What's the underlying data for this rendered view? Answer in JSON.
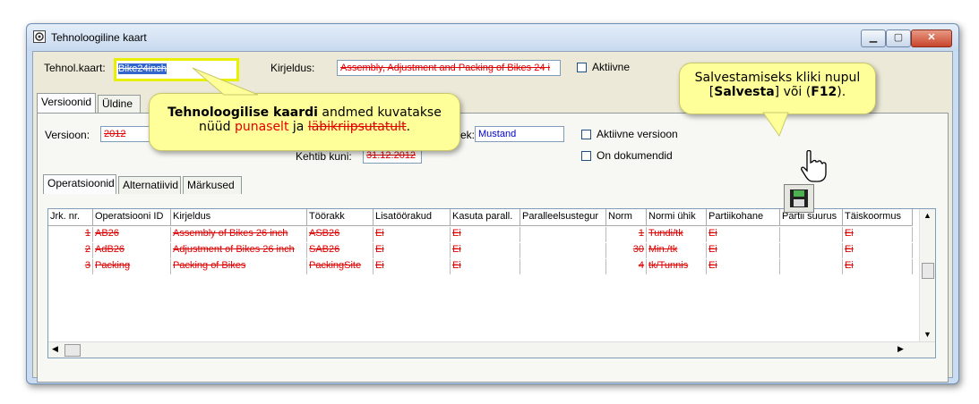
{
  "window": {
    "title": "Tehnoloogiline kaart"
  },
  "header": {
    "card_label": "Tehnol.kaart:",
    "card_value": "Bike24inch",
    "desc_label": "Kirjeldus:",
    "desc_value": "Assembly, Adjustment and Packing of Bikes 24 i",
    "active_label": "Aktiivne"
  },
  "top_tabs": [
    {
      "label": "Versioonid"
    },
    {
      "label": "Üldine"
    }
  ],
  "version": {
    "version_label": "Versioon:",
    "version_value": "2012",
    "status_label_suffix": "ek:",
    "status_value": "Mustand",
    "active_version_label": "Aktiivne versioon",
    "has_docs_label": "On dokumendid",
    "valid_until_label": "Kehtib kuni:",
    "valid_until_value": "31.12.2012"
  },
  "sub_tabs": [
    {
      "label": "Operatsioonid"
    },
    {
      "label": "Alternatiivid"
    },
    {
      "label": "Märkused"
    }
  ],
  "grid": {
    "columns": [
      "Jrk. nr.",
      "Operatsiooni ID",
      "Kirjeldus",
      "Töörakk",
      "Lisatöörakud",
      "Kasuta parall.",
      "Paralleelsustegur",
      "Norm",
      "Normi ühik",
      "Partiikohane",
      "Partii suurus",
      "Täiskoormus"
    ],
    "rows": [
      [
        "1",
        "AB26",
        "Assembly of Bikes 26 inch",
        "ASB26",
        "Ei",
        "Ei",
        "",
        "1",
        "Tundi/tk",
        "Ei",
        "",
        "Ei"
      ],
      [
        "2",
        "AdB26",
        "Adjustment of Bikes 26 inch",
        "SAB26",
        "Ei",
        "Ei",
        "",
        "30",
        "Min./tk",
        "Ei",
        "",
        "Ei"
      ],
      [
        "3",
        "Packing",
        "Packing of Bikes",
        "PackingSite",
        "Ei",
        "Ei",
        "",
        "4",
        "tk/Tunnis",
        "Ei",
        "",
        "Ei"
      ]
    ]
  },
  "callouts": {
    "main_bold": "Tehnoloogilise kaardi",
    "main_rest": " andmed kuvatakse",
    "main_line2_a": "nüüd ",
    "main_red": "punaselt",
    "main_line2_b": " ja ",
    "main_strike": "läbikriipsutatult",
    "main_end": ".",
    "save_line1": "Salvestamiseks kliki nupul",
    "save_open": "[",
    "save_bold": "Salvesta",
    "save_mid": "] või (",
    "save_key": "F12",
    "save_close": ")."
  },
  "colors": {
    "accent_red": "#e00000",
    "status_blue": "#0000cc",
    "callout_bg": "#ffff99"
  }
}
